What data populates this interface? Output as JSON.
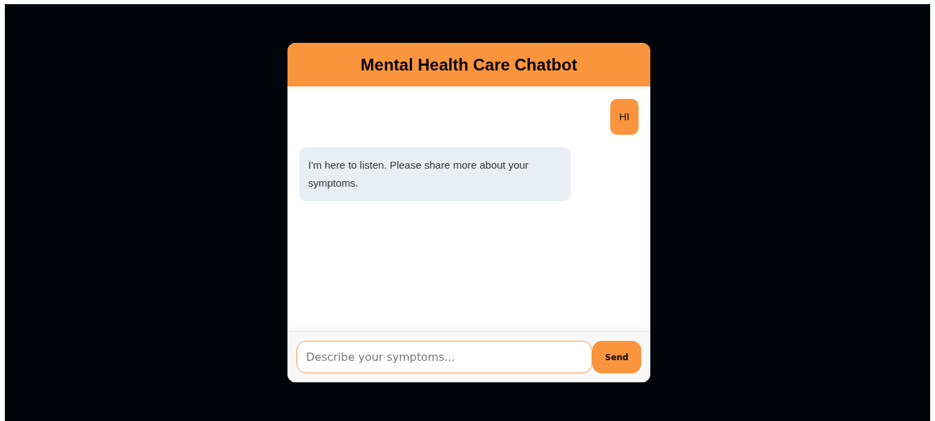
{
  "header": {
    "title": "Mental Health Care Chatbot"
  },
  "messages": [
    {
      "kind": "user",
      "text": "HI"
    },
    {
      "kind": "bot",
      "text": "I'm here to listen. Please share more about your symptoms."
    }
  ],
  "composer": {
    "placeholder": "Describe your symptoms...",
    "button": "Send"
  }
}
